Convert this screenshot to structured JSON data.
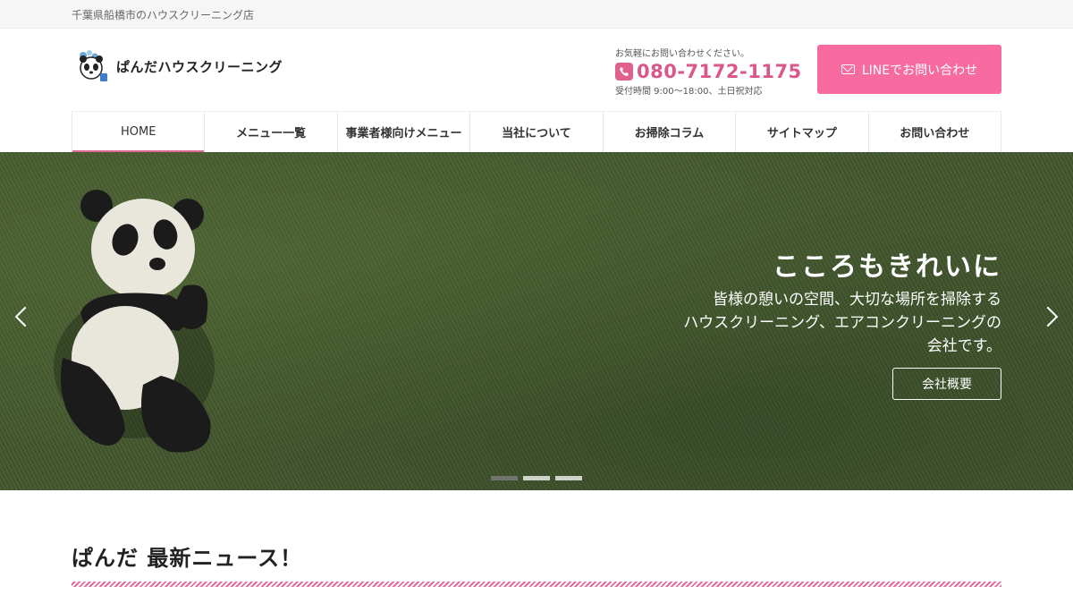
{
  "topbar": {
    "tagline": "千葉県船橋市のハウスクリーニング店"
  },
  "header": {
    "logo_text": "ぱんだハウスクリーニング",
    "contact_note": "お気軽にお問い合わせください。",
    "phone": "080-7172-1175",
    "hours": "受付時間 9:00〜18:00、土日祝対応",
    "line_button": "LINEでお問い合わせ"
  },
  "nav": {
    "items": [
      {
        "label": "HOME"
      },
      {
        "label": "メニュー一覧"
      },
      {
        "label": "事業者様向けメニュー"
      },
      {
        "label": "当社について"
      },
      {
        "label": "お掃除コラム"
      },
      {
        "label": "サイトマップ"
      },
      {
        "label": "お問い合わせ"
      }
    ],
    "active_index": 0
  },
  "hero": {
    "title": "こころもきれいに",
    "description_lines": [
      "皆様の憩いの空間、大切な場所を掃除する",
      "ハウスクリーニング、エアコンクリーニングの",
      "会社です。"
    ],
    "button": "会社概要",
    "slide_count": 3,
    "active_slide": 0
  },
  "news": {
    "title": "ぱんだ 最新ニュース！"
  },
  "colors": {
    "accent": "#f76ba0",
    "phone": "#d9578b",
    "grass": "#4d6534"
  },
  "icons": [
    "phone-icon",
    "mail-icon",
    "chevron-left-icon",
    "chevron-right-icon"
  ]
}
